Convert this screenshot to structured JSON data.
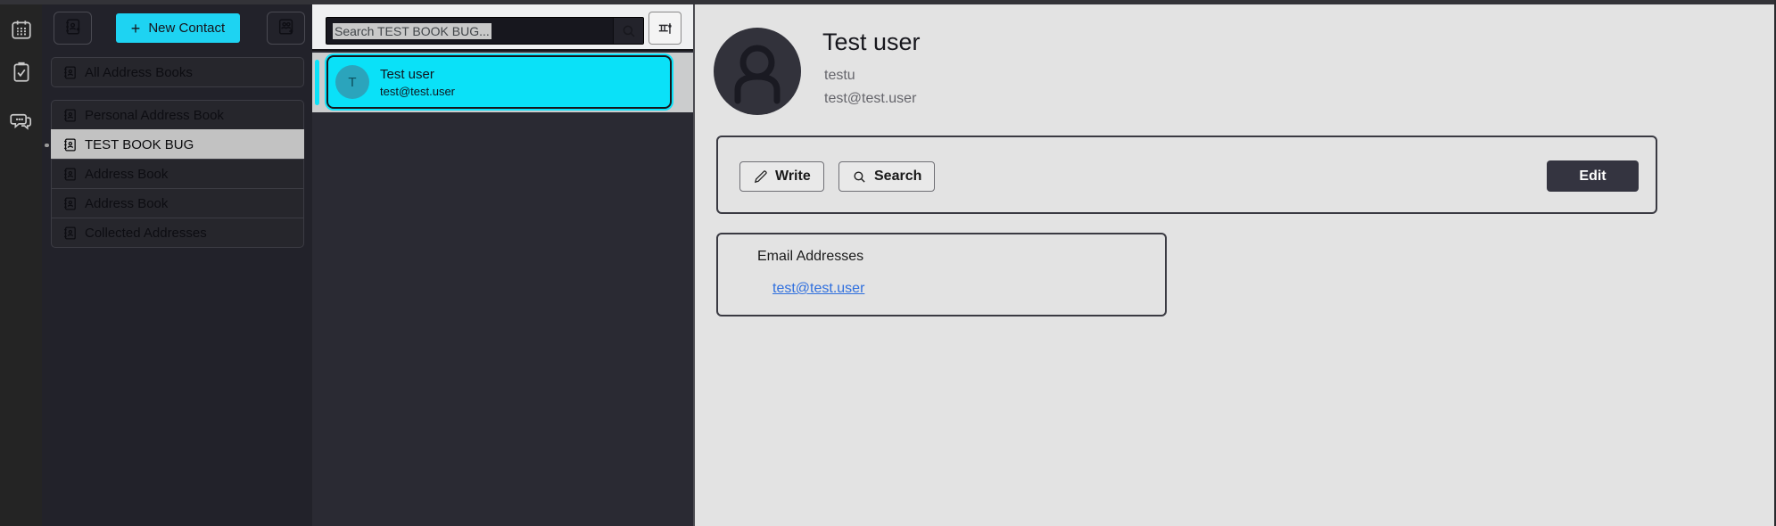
{
  "activity_bar": {
    "icons": [
      {
        "name": "calendar-icon"
      },
      {
        "name": "tasks-icon"
      },
      {
        "name": "chat-icon"
      }
    ]
  },
  "sidebar": {
    "new_contact": {
      "plus": "+",
      "label": "New Contact"
    },
    "icon_buttons": [
      {
        "name": "new-address-book-icon"
      },
      {
        "name": "new-list-icon"
      }
    ],
    "books": [
      {
        "label": "All Address Books",
        "selected": false
      },
      {
        "label": "Personal Address Book",
        "selected": false
      },
      {
        "label": "TEST BOOK BUG",
        "selected": true
      },
      {
        "label": "Address Book",
        "selected": false
      },
      {
        "label": "Address Book",
        "selected": false
      },
      {
        "label": "Collected Addresses",
        "selected": false
      }
    ]
  },
  "contacts_panel": {
    "search_placeholder": "Search TEST BOOK BUG...",
    "contact": {
      "initial": "T",
      "name": "Test user",
      "email": "test@test.user"
    }
  },
  "detail": {
    "name": "Test user",
    "nickname": "testu",
    "email": "test@test.user",
    "write_label": "Write",
    "search_label": "Search",
    "edit_label": "Edit",
    "email_section": {
      "title": "Email Addresses",
      "link": "test@test.user"
    }
  },
  "colors": {
    "accent_cyan": "#0ae1f8",
    "new_contact_cyan": "#1ed3f2",
    "selected_book_gray": "#c2c2c2",
    "link_blue": "#2f6fde",
    "sidebar_bg": "#22222a",
    "list_bg": "#2a2a33",
    "detail_bg": "#e3e3e3",
    "edit_button_bg": "#343440"
  }
}
